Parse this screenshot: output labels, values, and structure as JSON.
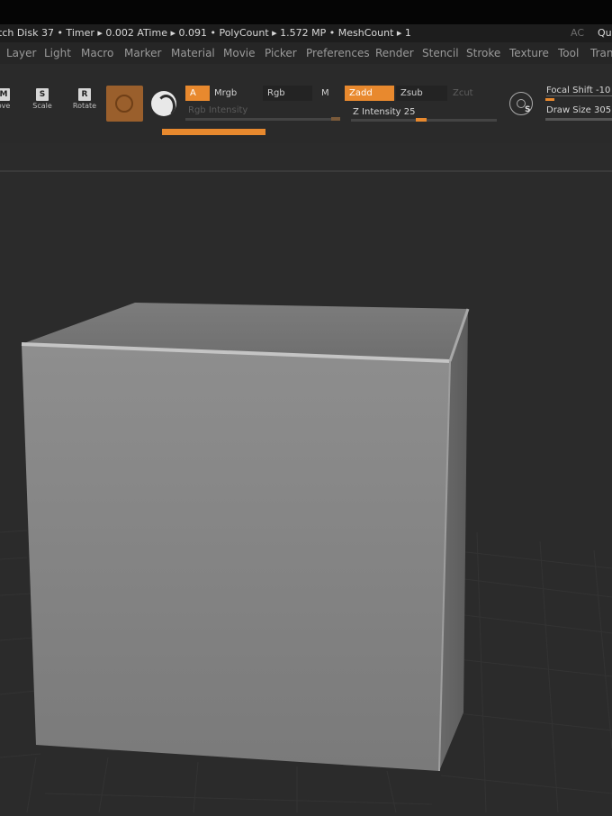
{
  "statusbar": {
    "text": "tch Disk 37 • Timer ▸ 0.002 ATime ▸ 0.091 • PolyCount ▸ 1.572 MP • MeshCount ▸ 1",
    "ac": "AC",
    "qu": "Qu"
  },
  "menu": [
    "Layer",
    "Light",
    "Macro",
    "Marker",
    "Material",
    "Movie",
    "Picker",
    "Preferences",
    "Render",
    "Stencil",
    "Stroke",
    "Texture",
    "Tool",
    "Tran"
  ],
  "toolbar": {
    "move": {
      "icon": "M",
      "label": "ove"
    },
    "scale": {
      "icon": "S",
      "label": "Scale"
    },
    "rotate": {
      "icon": "R",
      "label": "Rotate"
    },
    "a_label": "A",
    "mrgb_label": "Mrgb",
    "rgb_label": "Rgb",
    "m_label": "M",
    "zadd_label": "Zadd",
    "zsub_label": "Zsub",
    "zcut_label": "Zcut",
    "rgb_intensity_label": "Rgb Intensity",
    "z_intensity_label": "Z Intensity 25",
    "focal_shift_label": "Focal Shift -10",
    "draw_size_label": "Draw Size 305",
    "focal_icon_letter": "S"
  },
  "colors": {
    "accent": "#e8892e",
    "background": "#2b2b2b",
    "cube": "#8a8a8a"
  }
}
